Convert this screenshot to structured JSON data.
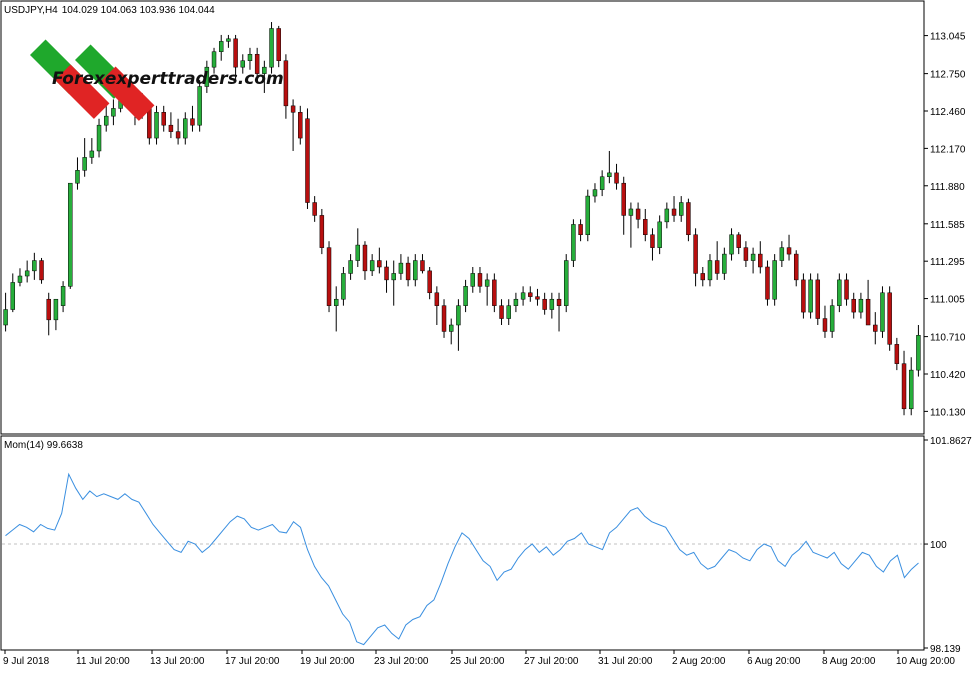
{
  "chart_data": {
    "type": "candlestick",
    "symbol_header": {
      "symbol": "USDJPY,H4",
      "ohlc": "104.029 104.063 103.936 104.044"
    },
    "price_axis_ticks": [
      "113.045",
      "112.750",
      "112.460",
      "112.170",
      "111.880",
      "111.585",
      "111.295",
      "111.005",
      "110.710",
      "110.420",
      "110.130"
    ],
    "ylim": [
      109.97,
      113.29
    ],
    "time_axis_ticks": [
      "9 Jul 2018",
      "11 Jul 20:00",
      "13 Jul 20:00",
      "17 Jul 20:00",
      "19 Jul 20:00",
      "23 Jul 20:00",
      "25 Jul 20:00",
      "27 Jul 20:00",
      "31 Jul 20:00",
      "2 Aug 20:00",
      "6 Aug 20:00",
      "8 Aug 20:00",
      "10 Aug 20:00"
    ],
    "candles": [
      [
        110.8,
        111.05,
        110.75,
        110.92
      ],
      [
        110.92,
        111.2,
        110.9,
        111.13
      ],
      [
        111.13,
        111.24,
        111.1,
        111.18
      ],
      [
        111.18,
        111.3,
        111.13,
        111.22
      ],
      [
        111.22,
        111.36,
        111.15,
        111.3
      ],
      [
        111.3,
        111.32,
        111.12,
        111.15
      ],
      [
        111.0,
        111.05,
        110.72,
        110.84
      ],
      [
        110.84,
        111.0,
        110.76,
        111.0
      ],
      [
        110.95,
        111.14,
        110.9,
        111.1
      ],
      [
        111.1,
        111.7,
        111.08,
        111.9
      ],
      [
        111.9,
        112.1,
        111.85,
        112.0
      ],
      [
        112.0,
        112.25,
        111.95,
        112.1
      ],
      [
        112.1,
        112.25,
        112.05,
        112.15
      ],
      [
        112.15,
        112.4,
        112.1,
        112.35
      ],
      [
        112.35,
        112.5,
        112.3,
        112.42
      ],
      [
        112.42,
        112.55,
        112.35,
        112.48
      ],
      [
        112.48,
        112.7,
        112.45,
        112.6
      ],
      [
        112.6,
        112.65,
        112.5,
        112.55
      ],
      [
        112.55,
        112.6,
        112.35,
        112.45
      ],
      [
        112.45,
        112.6,
        112.4,
        112.5
      ],
      [
        112.5,
        112.52,
        112.2,
        112.25
      ],
      [
        112.25,
        112.5,
        112.2,
        112.45
      ],
      [
        112.45,
        112.5,
        112.3,
        112.35
      ],
      [
        112.35,
        112.45,
        112.25,
        112.3
      ],
      [
        112.3,
        112.4,
        112.2,
        112.25
      ],
      [
        112.25,
        112.45,
        112.2,
        112.4
      ],
      [
        112.4,
        112.5,
        112.3,
        112.35
      ],
      [
        112.35,
        112.7,
        112.3,
        112.65
      ],
      [
        112.65,
        112.85,
        112.6,
        112.8
      ],
      [
        112.8,
        112.95,
        112.75,
        112.92
      ],
      [
        112.92,
        113.05,
        112.85,
        113.0
      ],
      [
        113.0,
        113.05,
        112.95,
        113.02
      ],
      [
        113.02,
        113.05,
        112.7,
        112.8
      ],
      [
        112.8,
        112.9,
        112.75,
        112.85
      ],
      [
        112.85,
        112.95,
        112.78,
        112.9
      ],
      [
        112.9,
        112.95,
        112.7,
        112.75
      ],
      [
        112.75,
        112.85,
        112.6,
        112.8
      ],
      [
        112.8,
        113.15,
        112.75,
        113.1
      ],
      [
        113.1,
        113.12,
        112.8,
        112.85
      ],
      [
        112.85,
        112.9,
        112.4,
        112.5
      ],
      [
        112.5,
        112.55,
        112.15,
        112.45
      ],
      [
        112.45,
        112.5,
        112.2,
        112.25
      ],
      [
        112.4,
        112.48,
        111.7,
        111.75
      ],
      [
        111.75,
        111.8,
        111.6,
        111.65
      ],
      [
        111.65,
        111.7,
        111.35,
        111.4
      ],
      [
        111.4,
        111.45,
        110.9,
        110.95
      ],
      [
        110.95,
        111.1,
        110.75,
        111.0
      ],
      [
        111.0,
        111.25,
        110.95,
        111.2
      ],
      [
        111.2,
        111.35,
        111.15,
        111.3
      ],
      [
        111.3,
        111.55,
        111.25,
        111.42
      ],
      [
        111.42,
        111.45,
        111.15,
        111.22
      ],
      [
        111.22,
        111.35,
        111.18,
        111.3
      ],
      [
        111.3,
        111.4,
        111.2,
        111.25
      ],
      [
        111.25,
        111.3,
        111.05,
        111.15
      ],
      [
        111.15,
        111.3,
        110.95,
        111.2
      ],
      [
        111.2,
        111.35,
        111.15,
        111.28
      ],
      [
        111.28,
        111.33,
        111.1,
        111.15
      ],
      [
        111.15,
        111.35,
        111.1,
        111.3
      ],
      [
        111.3,
        111.35,
        111.2,
        111.22
      ],
      [
        111.22,
        111.25,
        111.0,
        111.05
      ],
      [
        111.05,
        111.1,
        110.8,
        110.95
      ],
      [
        110.95,
        111.0,
        110.7,
        110.75
      ],
      [
        110.75,
        110.85,
        110.65,
        110.8
      ],
      [
        110.8,
        111.0,
        110.6,
        110.95
      ],
      [
        110.95,
        111.15,
        110.9,
        111.1
      ],
      [
        111.1,
        111.25,
        111.05,
        111.2
      ],
      [
        111.2,
        111.25,
        111.05,
        111.1
      ],
      [
        111.1,
        111.2,
        110.95,
        111.15
      ],
      [
        111.15,
        111.2,
        110.9,
        110.95
      ],
      [
        110.95,
        111.0,
        110.8,
        110.85
      ],
      [
        110.85,
        111.0,
        110.8,
        110.95
      ],
      [
        110.95,
        111.05,
        110.9,
        111.0
      ],
      [
        111.0,
        111.1,
        110.95,
        111.05
      ],
      [
        111.05,
        111.1,
        110.98,
        111.02
      ],
      [
        111.02,
        111.08,
        110.95,
        111.0
      ],
      [
        111.0,
        111.05,
        110.88,
        110.92
      ],
      [
        110.92,
        111.05,
        110.85,
        111.0
      ],
      [
        111.0,
        111.05,
        110.75,
        110.95
      ],
      [
        110.95,
        111.35,
        110.9,
        111.3
      ],
      [
        111.3,
        111.62,
        111.25,
        111.58
      ],
      [
        111.58,
        111.62,
        111.45,
        111.5
      ],
      [
        111.5,
        111.85,
        111.45,
        111.8
      ],
      [
        111.8,
        111.9,
        111.75,
        111.85
      ],
      [
        111.85,
        112.0,
        111.8,
        111.95
      ],
      [
        111.95,
        112.15,
        111.9,
        111.98
      ],
      [
        111.98,
        112.05,
        111.85,
        111.9
      ],
      [
        111.9,
        111.95,
        111.5,
        111.65
      ],
      [
        111.65,
        111.75,
        111.4,
        111.7
      ],
      [
        111.7,
        111.75,
        111.55,
        111.62
      ],
      [
        111.62,
        111.7,
        111.45,
        111.5
      ],
      [
        111.5,
        111.55,
        111.3,
        111.4
      ],
      [
        111.4,
        111.65,
        111.35,
        111.6
      ],
      [
        111.6,
        111.75,
        111.55,
        111.7
      ],
      [
        111.7,
        111.8,
        111.6,
        111.65
      ],
      [
        111.65,
        111.8,
        111.6,
        111.75
      ],
      [
        111.75,
        111.78,
        111.45,
        111.5
      ],
      [
        111.5,
        111.55,
        111.1,
        111.2
      ],
      [
        111.2,
        111.25,
        111.1,
        111.15
      ],
      [
        111.15,
        111.35,
        111.1,
        111.3
      ],
      [
        111.3,
        111.45,
        111.15,
        111.2
      ],
      [
        111.2,
        111.4,
        111.15,
        111.35
      ],
      [
        111.35,
        111.55,
        111.3,
        111.5
      ],
      [
        111.5,
        111.52,
        111.35,
        111.4
      ],
      [
        111.4,
        111.45,
        111.25,
        111.3
      ],
      [
        111.3,
        111.4,
        111.2,
        111.35
      ],
      [
        111.35,
        111.45,
        111.2,
        111.25
      ],
      [
        111.25,
        111.3,
        110.95,
        111.0
      ],
      [
        111.0,
        111.35,
        110.95,
        111.3
      ],
      [
        111.3,
        111.45,
        111.25,
        111.4
      ],
      [
        111.4,
        111.5,
        111.3,
        111.35
      ],
      [
        111.35,
        111.38,
        111.1,
        111.15
      ],
      [
        111.15,
        111.2,
        110.85,
        110.9
      ],
      [
        110.9,
        111.2,
        110.85,
        111.15
      ],
      [
        111.15,
        111.2,
        110.8,
        110.85
      ],
      [
        110.85,
        110.95,
        110.7,
        110.75
      ],
      [
        110.75,
        111.0,
        110.7,
        110.95
      ],
      [
        110.95,
        111.2,
        110.9,
        111.15
      ],
      [
        111.15,
        111.2,
        110.95,
        111.0
      ],
      [
        111.0,
        111.05,
        110.85,
        110.9
      ],
      [
        110.9,
        111.05,
        110.85,
        111.0
      ],
      [
        111.0,
        111.15,
        110.95,
        110.8
      ],
      [
        110.8,
        110.9,
        110.65,
        110.75
      ],
      [
        110.75,
        111.1,
        110.7,
        111.05
      ],
      [
        111.05,
        111.1,
        110.6,
        110.65
      ],
      [
        110.65,
        110.7,
        110.45,
        110.5
      ],
      [
        110.5,
        110.6,
        110.1,
        110.15
      ],
      [
        110.15,
        110.55,
        110.1,
        110.45
      ],
      [
        110.45,
        110.8,
        110.4,
        110.72
      ]
    ],
    "momentum": {
      "label": "Mom(14) 99.6638",
      "period": 14,
      "axis_ticks": [
        "101.8627",
        "100",
        "98.139"
      ],
      "ylim": [
        98.139,
        101.8627
      ],
      "baseline": 100,
      "values": [
        100.15,
        100.25,
        100.35,
        100.3,
        100.22,
        100.35,
        100.28,
        100.25,
        100.55,
        101.25,
        101.0,
        100.8,
        100.95,
        100.85,
        100.9,
        100.85,
        100.8,
        100.9,
        100.8,
        100.75,
        100.55,
        100.35,
        100.2,
        100.05,
        99.9,
        99.85,
        100.05,
        100.0,
        99.85,
        99.95,
        100.1,
        100.25,
        100.4,
        100.5,
        100.45,
        100.3,
        100.25,
        100.3,
        100.35,
        100.22,
        100.2,
        100.4,
        100.3,
        99.9,
        99.6,
        99.4,
        99.25,
        99.0,
        98.75,
        98.6,
        98.25,
        98.2,
        98.35,
        98.5,
        98.55,
        98.4,
        98.3,
        98.55,
        98.65,
        98.7,
        98.9,
        99.0,
        99.3,
        99.65,
        99.95,
        100.2,
        100.1,
        99.9,
        99.7,
        99.6,
        99.35,
        99.5,
        99.55,
        99.75,
        99.9,
        100.0,
        99.85,
        99.95,
        99.8,
        99.9,
        100.05,
        100.1,
        100.2,
        100.0,
        99.95,
        99.9,
        100.2,
        100.3,
        100.45,
        100.6,
        100.65,
        100.5,
        100.4,
        100.35,
        100.3,
        100.1,
        99.9,
        99.8,
        99.85,
        99.65,
        99.55,
        99.6,
        99.75,
        99.9,
        99.85,
        99.75,
        99.7,
        99.9,
        100.0,
        99.95,
        99.7,
        99.6,
        99.8,
        99.9,
        100.05,
        99.85,
        99.8,
        99.75,
        99.85,
        99.65,
        99.55,
        99.7,
        99.85,
        99.8,
        99.6,
        99.5,
        99.7,
        99.8,
        99.4,
        99.55,
        99.66
      ]
    }
  },
  "watermark": {
    "text": "Forexexperttraders.com",
    "colors": {
      "green": "#1fa82c",
      "red": "#e02424"
    }
  },
  "colors": {
    "bull": "#27ae3b",
    "bear": "#b80f0f",
    "wick": "#000000",
    "momentum_line": "#3a8fe0",
    "baseline": "#c0c0c0",
    "frame": "#000000",
    "background": "#ffffff"
  }
}
